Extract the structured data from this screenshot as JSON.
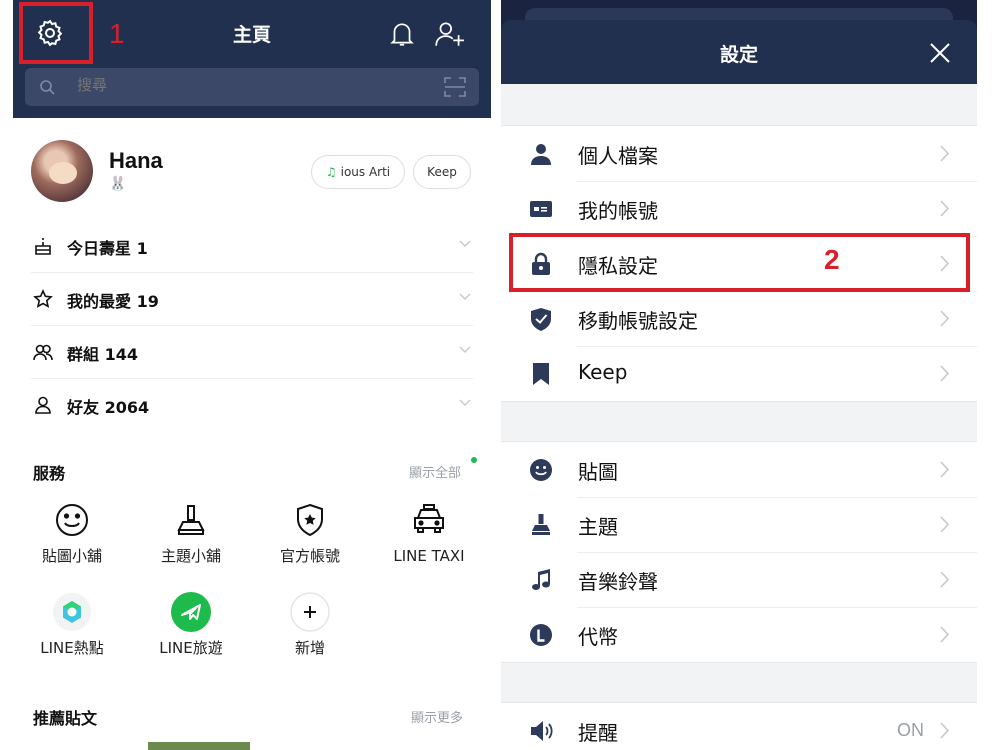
{
  "home": {
    "title": "主頁",
    "step_marker": "1",
    "search_placeholder": "搜尋",
    "profile": {
      "name": "Hana",
      "sticker": "🐰",
      "music_label": "ious Arti",
      "keep_label": "Keep"
    },
    "groups": [
      {
        "label": "今日壽星 1",
        "icon": "cake-icon"
      },
      {
        "label": "我的最愛 19",
        "icon": "star-icon"
      },
      {
        "label": "群組 144",
        "icon": "group-icon"
      },
      {
        "label": "好友 2064",
        "icon": "friend-icon"
      }
    ],
    "services": {
      "title": "服務",
      "show_all": "顯示全部",
      "items": [
        {
          "label": "貼圖小舖",
          "icon": "smiley-icon"
        },
        {
          "label": "主題小舖",
          "icon": "brush-icon"
        },
        {
          "label": "官方帳號",
          "icon": "shield-star-icon"
        },
        {
          "label": "LINE TAXI",
          "icon": "taxi-icon"
        },
        {
          "label": "LINE熱點",
          "icon": "hotspot-icon"
        },
        {
          "label": "LINE旅遊",
          "icon": "plane-icon"
        },
        {
          "label": "新增",
          "icon": "plus-icon"
        }
      ]
    },
    "recommended": {
      "title": "推薦貼文",
      "show_more": "顯示更多"
    }
  },
  "settings": {
    "title": "設定",
    "step_marker": "2",
    "group1": [
      {
        "label": "個人檔案",
        "icon": "person-icon"
      },
      {
        "label": "我的帳號",
        "icon": "id-card-icon"
      },
      {
        "label": "隱私設定",
        "icon": "lock-icon"
      },
      {
        "label": "移動帳號設定",
        "icon": "shield-check-icon"
      },
      {
        "label": "Keep",
        "icon": "bookmark-icon"
      }
    ],
    "group2": [
      {
        "label": "貼圖",
        "icon": "smiley-fill-icon"
      },
      {
        "label": "主題",
        "icon": "brush-fill-icon"
      },
      {
        "label": "音樂鈴聲",
        "icon": "music-note-icon"
      },
      {
        "label": "代幣",
        "icon": "coin-icon"
      }
    ],
    "group3": [
      {
        "label": "提醒",
        "icon": "speaker-icon",
        "value": "ON"
      }
    ]
  },
  "colors": {
    "header_navy": "#223050",
    "highlight_red": "#d8202a",
    "line_green": "#1dbb4c"
  }
}
